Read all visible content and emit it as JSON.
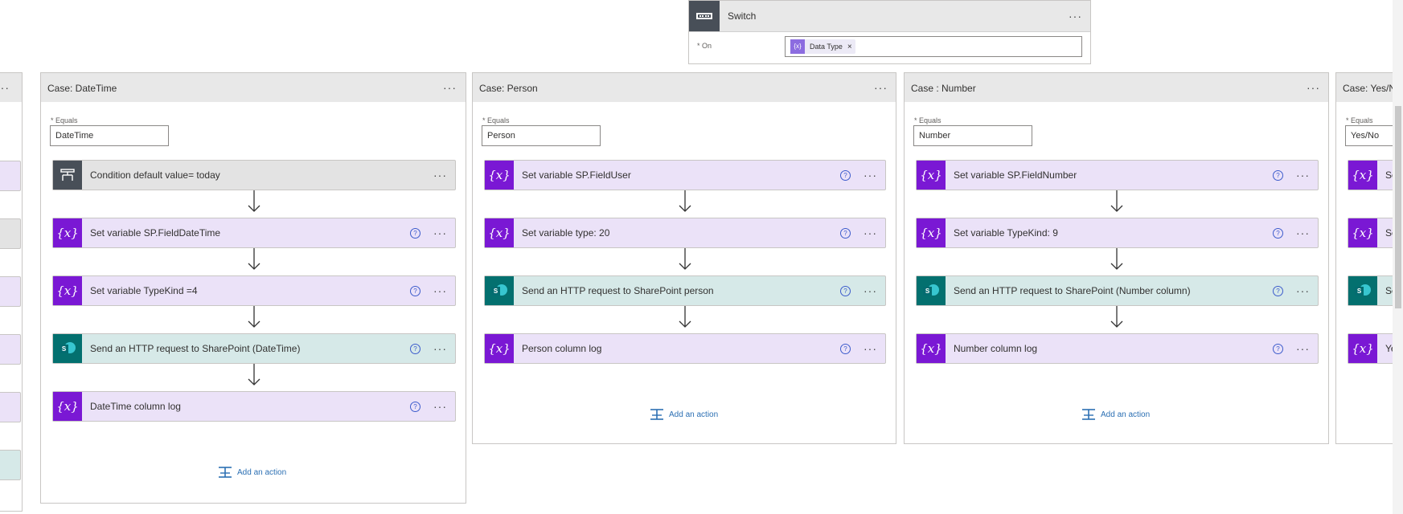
{
  "switch": {
    "title": "Switch",
    "on_label": "* On",
    "token": "Data Type",
    "token_icon": "{x}",
    "token_close": "×"
  },
  "menu_dots": "···",
  "help_glyph": "?",
  "var_icon_glyph": "{x}",
  "sp_glyph": "S",
  "cases": [
    {
      "title": "Case: DateTime",
      "equals_label": "* Equals",
      "equals_value": "DateTime",
      "actions": [
        {
          "label": "Condition default value= today"
        },
        {
          "label": "Set variable SP.FieldDateTime"
        },
        {
          "label": "Set variable TypeKind =4"
        },
        {
          "label": "Send an HTTP request to SharePoint (DateTime)"
        },
        {
          "label": "DateTime column log"
        }
      ],
      "add_action": "Add an action"
    },
    {
      "title": "Case: Person",
      "equals_label": "* Equals",
      "equals_value": "Person",
      "actions": [
        {
          "label": "Set variable SP.FieldUser"
        },
        {
          "label": "Set variable type: 20"
        },
        {
          "label": "Send an HTTP request to SharePoint person"
        },
        {
          "label": "Person column log"
        }
      ],
      "add_action": "Add an action"
    },
    {
      "title": "Case : Number",
      "equals_label": "* Equals",
      "equals_value": "Number",
      "actions": [
        {
          "label": "Set variable SP.FieldNumber"
        },
        {
          "label": "Set variable TypeKind: 9"
        },
        {
          "label": "Send an HTTP request to SharePoint (Number column)"
        },
        {
          "label": "Number column log"
        }
      ],
      "add_action": "Add an action"
    },
    {
      "title": "Case: Yes/No",
      "equals_label": "* Equals",
      "equals_value": "Yes/No",
      "actions": [
        {
          "label": "Se"
        },
        {
          "label": "Se"
        },
        {
          "label": "Se"
        },
        {
          "label": "Ye"
        }
      ]
    }
  ]
}
